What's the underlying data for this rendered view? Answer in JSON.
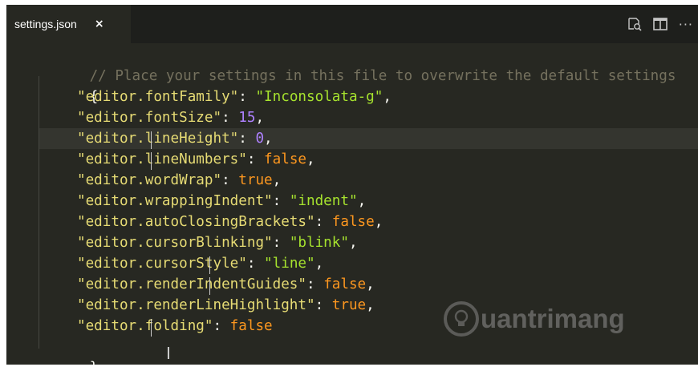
{
  "tab": {
    "filename": "settings.json",
    "close_glyph": "×"
  },
  "toolbar": {
    "more_glyph": "···"
  },
  "editor": {
    "comment": "// Place your settings in this file to overwrite the default settings",
    "open_brace": "{",
    "close_brace": "}",
    "settings": [
      {
        "key": "\"editor.fontFamily\"",
        "value": "\"Inconsolata-g\"",
        "type": "string",
        "comma": ","
      },
      {
        "key": "\"editor.fontSize\"",
        "value": "15",
        "type": "number",
        "comma": ","
      },
      {
        "key": "\"editor.lineHeight\"",
        "value": "0",
        "type": "number",
        "comma": ","
      },
      {
        "key": "\"editor.lineNumbers\"",
        "value": "false",
        "type": "keyword",
        "comma": ","
      },
      {
        "key": "\"editor.wordWrap\"",
        "value": "true",
        "type": "keyword",
        "comma": ","
      },
      {
        "key": "\"editor.wrappingIndent\"",
        "value": "\"indent\"",
        "type": "string",
        "comma": ","
      },
      {
        "key": "\"editor.autoClosingBrackets\"",
        "value": "false",
        "type": "keyword",
        "comma": ","
      },
      {
        "key": "\"editor.cursorBlinking\"",
        "value": "\"blink\"",
        "type": "string",
        "comma": ","
      },
      {
        "key": "\"editor.cursorStyle\"",
        "value": "\"line\"",
        "type": "string",
        "comma": ","
      },
      {
        "key": "\"editor.renderIndentGuides\"",
        "value": "false",
        "type": "keyword",
        "comma": ","
      },
      {
        "key": "\"editor.renderLineHighlight\"",
        "value": "true",
        "type": "keyword",
        "comma": ","
      },
      {
        "key": "\"editor.folding\"",
        "value": "false",
        "type": "keyword",
        "comma": ""
      }
    ]
  },
  "watermark": {
    "text": "uantrimang"
  },
  "colors": {
    "background": "#272822",
    "comment": "#75715e",
    "key": "#e6db74",
    "string": "#a6e22e",
    "number": "#ae81ff",
    "keyword": "#fd971f"
  }
}
